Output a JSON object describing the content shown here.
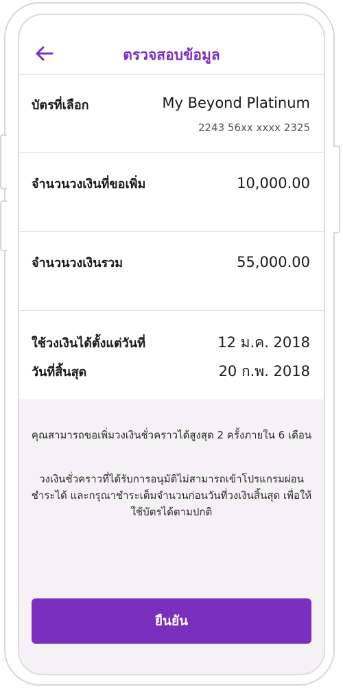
{
  "header": {
    "title": "ตรวจสอบข้อมูล",
    "back_icon": "arrow-left-icon"
  },
  "card": {
    "label": "บัตรที่เลือก",
    "name": "My Beyond Platinum",
    "number": "2243 56xx xxxx 2325"
  },
  "requested_limit": {
    "label": "จำนวนวงเงินที่ขอเพิ่ม",
    "value": "10,000.00"
  },
  "total_limit": {
    "label": "จำนวนวงเงินรวม",
    "value": "55,000.00"
  },
  "period": {
    "start_label": "ใช้วงเงินได้ตั้งแต่วันที่",
    "start_value": "12 ม.ค. 2018",
    "end_label": "วันที่สิ้นสุด",
    "end_value": "20 ก.พ. 2018"
  },
  "info": {
    "note1": "คุณสามารถขอเพิ่มวงเงินชั่วคราวได้สูงสุด 2 ครั้งภายใน 6 เดือน",
    "note2": "วงเงินชั่วคราวที่ได้รับการอนุมัติไม่สามารถเข้าโปรแกรมผ่อนชำระได้ และกรุณาชำระเต็มจำนวนก่อนวันที่วงเงินสิ้นสุด เพื่อให้ใช้บัตรได้ตามปกติ"
  },
  "confirm": {
    "label": "ยืนยัน"
  },
  "colors": {
    "accent": "#7b2fbe",
    "info_bg": "#f4f2f4"
  }
}
